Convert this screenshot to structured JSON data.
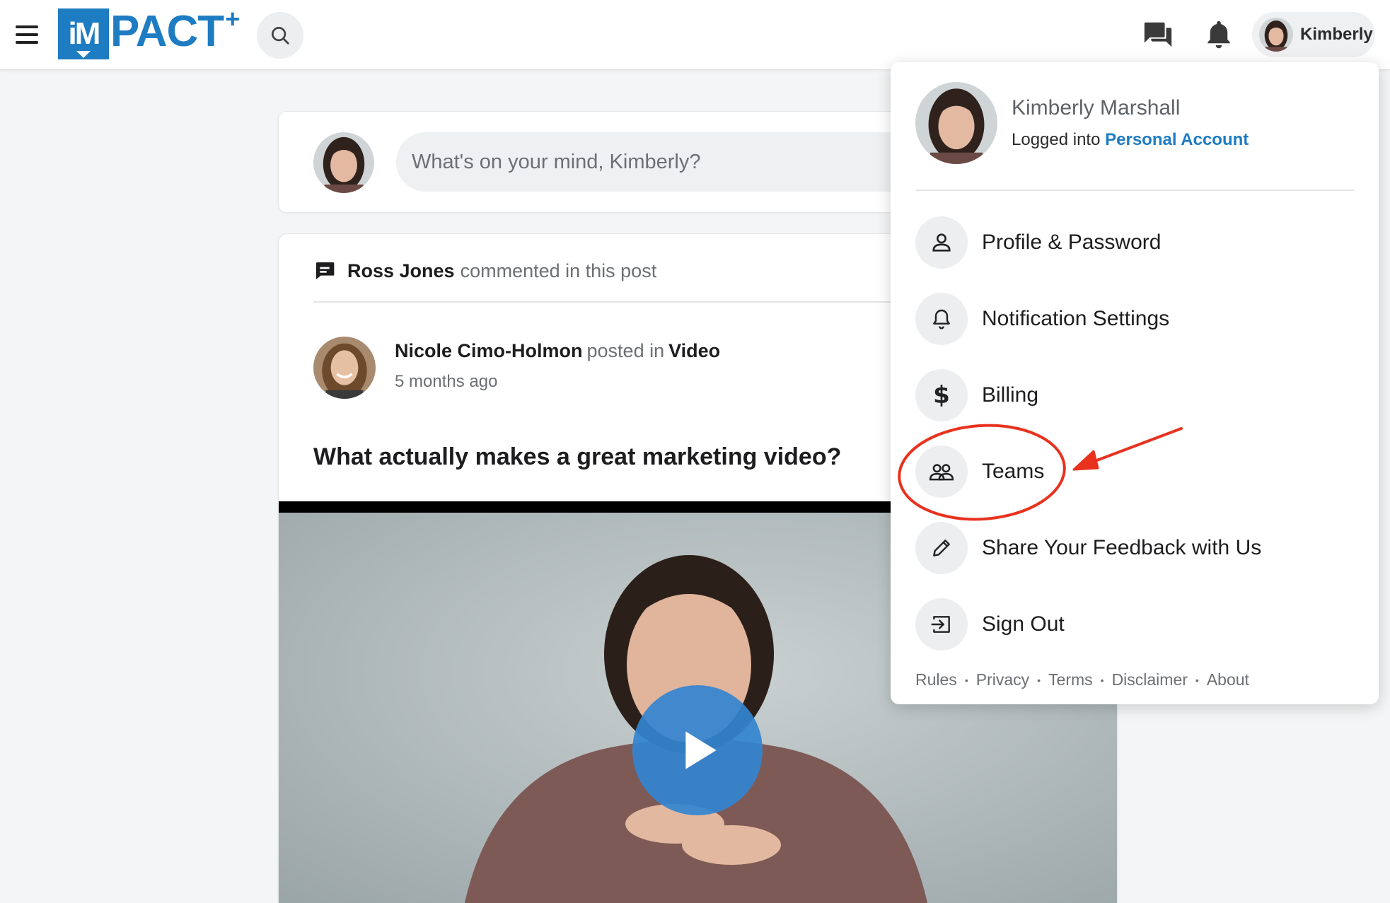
{
  "header": {
    "logo_letters": "iM",
    "logo_text": "PACT",
    "logo_plus": "+",
    "user_name": "Kimberly"
  },
  "composer": {
    "placeholder": "What's on your mind, Kimberly?"
  },
  "post": {
    "activity_actor": "Ross Jones",
    "activity_verb": "commented in this post",
    "author": "Nicole Cimo-Holmon",
    "posted_in": "posted in",
    "space": "Video",
    "time": "5 months ago",
    "title": "What actually makes a great marketing video?"
  },
  "menu": {
    "full_name": "Kimberly Marshall",
    "logged_into": "Logged into",
    "account": "Personal Account",
    "items": [
      {
        "label": "Profile & Password",
        "icon": "person-icon"
      },
      {
        "label": "Notification Settings",
        "icon": "bell-icon"
      },
      {
        "label": "Billing",
        "icon": "dollar-icon"
      },
      {
        "label": "Teams",
        "icon": "people-icon"
      },
      {
        "label": "Share Your Feedback with Us",
        "icon": "pencil-icon"
      },
      {
        "label": "Sign Out",
        "icon": "sign-out-icon"
      }
    ],
    "footer_links": [
      "Rules",
      "Privacy",
      "Terms",
      "Disclaimer",
      "About"
    ]
  },
  "colors": {
    "brand": "#1e7cc2",
    "annotation": "#e8321e",
    "play": "#3384d0"
  }
}
